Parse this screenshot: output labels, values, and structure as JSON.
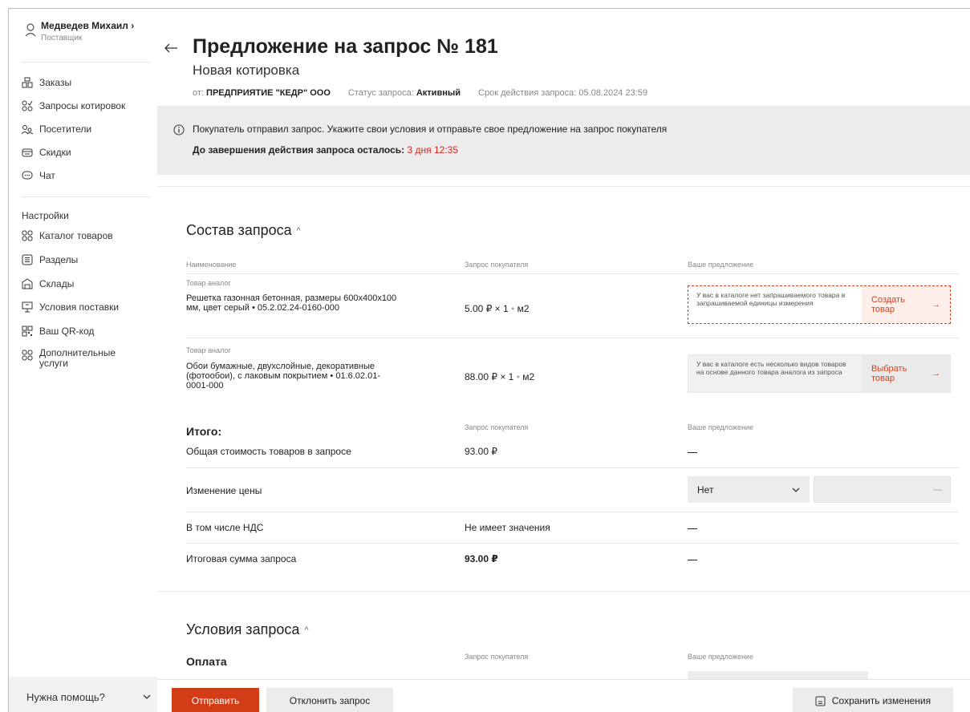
{
  "user": {
    "name": "Медведев Михаил",
    "role": "Поставщик"
  },
  "sidebar": {
    "items": [
      {
        "label": "Заказы",
        "icon": "orders-icon"
      },
      {
        "label": "Запросы котировок",
        "icon": "quote-requests-icon"
      },
      {
        "label": "Посетители",
        "icon": "visitors-icon"
      },
      {
        "label": "Скидки",
        "icon": "discounts-icon"
      },
      {
        "label": "Чат",
        "icon": "chat-icon"
      }
    ],
    "settings_heading": "Настройки",
    "settings_items": [
      {
        "label": "Каталог товаров",
        "icon": "catalog-icon"
      },
      {
        "label": "Разделы",
        "icon": "sections-icon"
      },
      {
        "label": "Склады",
        "icon": "warehouse-icon"
      },
      {
        "label": "Условия поставки",
        "icon": "delivery-terms-icon"
      },
      {
        "label": "Ваш QR-код",
        "icon": "qr-code-icon"
      },
      {
        "label": "Дополнительные услуги",
        "icon": "extra-services-icon"
      }
    ],
    "help_label": "Нужна помощь?"
  },
  "header": {
    "title": "Предложение на запрос № 181",
    "subtitle": "Новая котировка",
    "from_label": "от:",
    "from_value": "ПРЕДПРИЯТИЕ \"КЕДР\" ООО",
    "status_label": "Статус запроса:",
    "status_value": "Активный",
    "expiry_label": "Срок действия запроса:",
    "expiry_value": "05.08.2024 23:59"
  },
  "notice": {
    "text": "Покупатель отправил запрос. Укажите свои условия и отправьте свое предложение на запрос покупателя",
    "timer_label": "До завершения действия запроса осталось:",
    "timer_value": "3 дня 12:35",
    "timer_color": "#e0241d"
  },
  "composition": {
    "title": "Состав запроса",
    "col_name": "Наименование",
    "col_request": "Запрос покупателя",
    "col_offer": "Ваше предложение",
    "rows": [
      {
        "tag": "Товар аналог",
        "name": "Решетка газонная бетонная, размеры 600х400х100 мм, цвет серый • 05.2.02.24-0160-000",
        "price": "5.00 ₽",
        "mult": "× 1",
        "unit": "м2",
        "offer_text": "У вас в каталоге нет запрашиваемого товара в запрашиваемой единицы измерения",
        "offer_btn": "Создать товар"
      },
      {
        "tag": "Товар аналог",
        "name": "Обои бумажные, двухслойные, декоративные (фотообои), с лаковым покрытием • 01.6.02.01-0001-000",
        "price": "88.00 ₽",
        "mult": "× 1",
        "unit": "м2",
        "offer_text": "У вас в каталоге есть несколько видов товаров на основе данного товара аналога из запроса",
        "offer_btn": "Выбрать товар"
      }
    ]
  },
  "totals": {
    "title": "Итого:",
    "col_request": "Запрос покупателя",
    "col_offer": "Ваше предложение",
    "total_cost_label": "Общая стоимость товаров в запросе",
    "total_cost_value": "93.00 ₽",
    "price_change_label": "Изменение цены",
    "price_change_select": "Нет",
    "price_change_input": "—",
    "vat_label": "В том числе НДС",
    "vat_value": "Не имеет значения",
    "final_label": "Итоговая сумма запроса",
    "final_value": "93.00 ₽"
  },
  "conditions": {
    "title": "Условия запроса",
    "payment_label": "Оплата",
    "col_request": "Запрос покупателя",
    "col_offer": "Ваше предложение"
  },
  "actions": {
    "send": "Отправить",
    "reject": "Отклонить запрос",
    "save": "Сохранить изменения"
  },
  "colors": {
    "accent": "#d23d17",
    "notice_bg": "#ececec"
  }
}
